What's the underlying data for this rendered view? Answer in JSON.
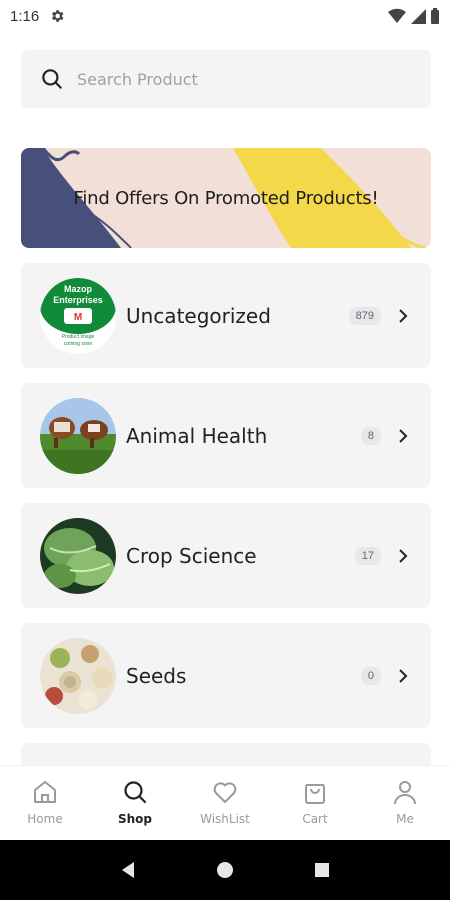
{
  "status_bar": {
    "time": "1:16"
  },
  "search": {
    "placeholder": "Search Product"
  },
  "banner": {
    "text": "Find Offers On Promoted Products!"
  },
  "categories": [
    {
      "name": "Uncategorized",
      "count": "879",
      "thumb_label": "Mazop Enterprises",
      "thumb_sub": "Product Image coming soon"
    },
    {
      "name": "Animal Health",
      "count": "8"
    },
    {
      "name": "Crop Science",
      "count": "17"
    },
    {
      "name": "Seeds",
      "count": "0"
    }
  ],
  "bottom_nav": {
    "items": [
      {
        "label": "Home",
        "icon": "home-icon"
      },
      {
        "label": "Shop",
        "icon": "search-icon",
        "active": true
      },
      {
        "label": "WishList",
        "icon": "heart-icon"
      },
      {
        "label": "Cart",
        "icon": "bag-icon"
      },
      {
        "label": "Me",
        "icon": "user-icon"
      }
    ]
  },
  "colors": {
    "card_bg": "#f4f4f4",
    "banner_bg": "#f1dfd8",
    "banner_navy": "#46507a",
    "banner_yellow": "#f3d84a",
    "green": "#118a3a"
  }
}
